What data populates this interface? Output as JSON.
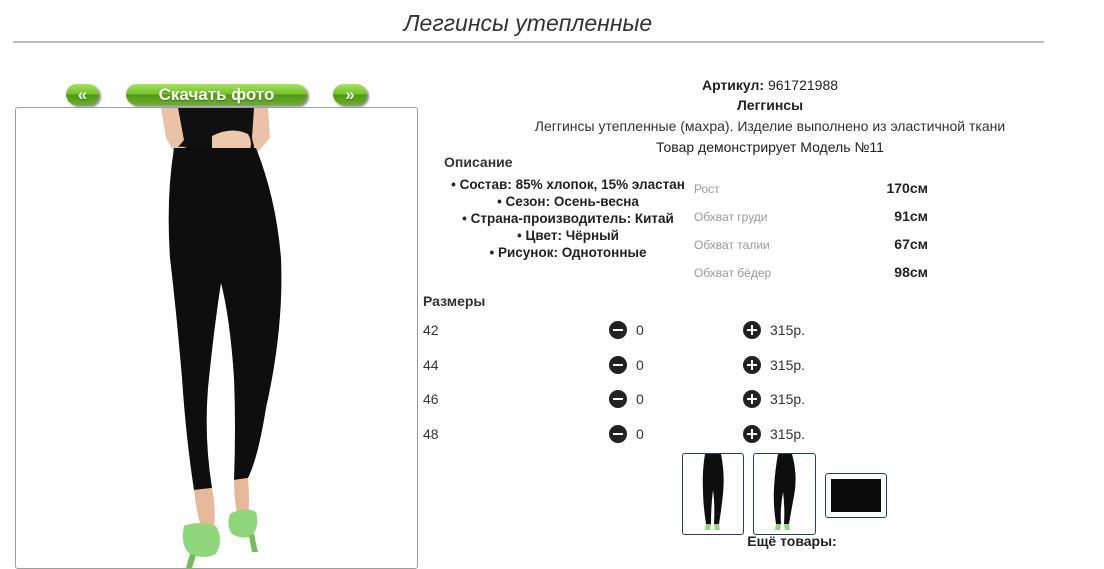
{
  "page": {
    "title": "Леггинсы утепленные"
  },
  "gallery": {
    "prev_label": "«",
    "download_label": "Скачать фото",
    "next_label": "»"
  },
  "product": {
    "article_label": "Артикул:",
    "article_value": "961721988",
    "category": "Леггинсы",
    "description": "Леггинсы утепленные (махра). Изделие выполнено из эластичной ткани",
    "model_line": "Товар демонстрирует Модель №11",
    "description_label": "Описание",
    "properties": [
      "Состав: 85% хлопок, 15% эластан",
      "Сезон: Осень-весна",
      "Страна-производитель: Китай",
      "Цвет: Чёрный",
      "Рисунок: Однотонные"
    ]
  },
  "measurements": [
    {
      "label": "Рост",
      "value": "170см"
    },
    {
      "label": "Обхват груди",
      "value": "91см"
    },
    {
      "label": "Обхват талии",
      "value": "67см"
    },
    {
      "label": "Обхват бёдер",
      "value": "98см"
    }
  ],
  "sizes": {
    "label": "Размеры",
    "rows": [
      {
        "size": "42",
        "qty": "0",
        "price": "315р."
      },
      {
        "size": "44",
        "qty": "0",
        "price": "315р."
      },
      {
        "size": "46",
        "qty": "0",
        "price": "315р."
      },
      {
        "size": "48",
        "qty": "0",
        "price": "315р."
      }
    ]
  },
  "more_goods_label": "Ещё товары:",
  "icons": {
    "minus": "minus-circle-icon",
    "plus": "plus-circle-icon"
  },
  "colors": {
    "button_green": "#74c12a",
    "thumb_border": "#1d3f73",
    "rule": "#bdbdbd"
  }
}
